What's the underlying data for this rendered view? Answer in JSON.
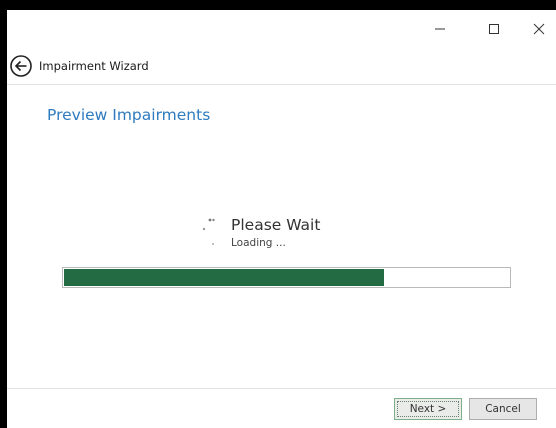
{
  "window": {
    "controls": {
      "minimize_icon": "minimize-icon",
      "maximize_icon": "maximize-icon",
      "close_icon": "close-icon"
    }
  },
  "header": {
    "back_icon": "back-arrow-icon",
    "title": "Impairment Wizard"
  },
  "main": {
    "section_title": "Preview Impairments",
    "status": {
      "title": "Please Wait",
      "subtitle": "Loading ...",
      "spinner_icon": "loading-spinner-icon"
    },
    "progress": {
      "value_percent": 72,
      "color": "#236b43"
    }
  },
  "footer": {
    "next_label": "Next >",
    "cancel_label": "Cancel"
  },
  "colors": {
    "accent": "#2e7bbf",
    "progress": "#236b43"
  }
}
